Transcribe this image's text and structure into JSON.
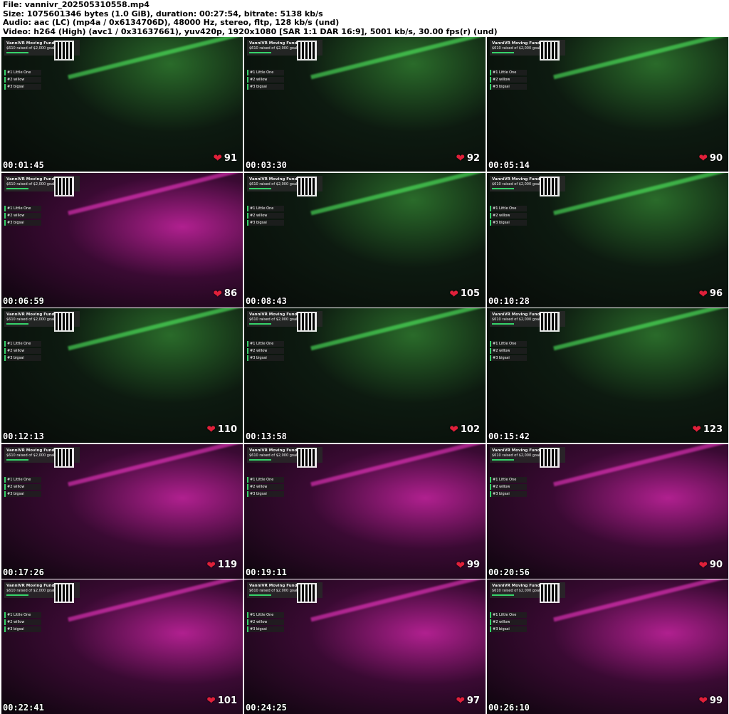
{
  "header": {
    "file": "File: vannivr_2025053105 58.mp4",
    "size": "Size: 1075601346 bytes (1.0 GiB), duration: 00:27:54, bitrate: 5138 kb/s",
    "audio": "Audio: aac (LC) (mp4a / 0x6134706D), 48000 Hz, stereo, fltp, 128 kb/s (und)",
    "video": "Video: h264 (High) (avc1 / 0x31637661), yuv420p, 1920x1080 [SAR 1:1 DAR 16:9], 5001 kb/s, 30.00 fps(r) (und)"
  },
  "overlay": {
    "fund_title": "VanniVR Moving Fund",
    "fund_progress": "$610 raised of $2,000 goal",
    "fund_fraction": 0.305,
    "leaderboard": [
      "#1 Little One",
      "#2 willow",
      "#3 bigsai"
    ]
  },
  "frames": [
    {
      "timestamp": "00:01:45",
      "likes": "91",
      "theme": "g"
    },
    {
      "timestamp": "00:03:30",
      "likes": "92",
      "theme": "g"
    },
    {
      "timestamp": "00:05:14",
      "likes": "90",
      "theme": "g"
    },
    {
      "timestamp": "00:06:59",
      "likes": "86",
      "theme": "m"
    },
    {
      "timestamp": "00:08:43",
      "likes": "105",
      "theme": "g"
    },
    {
      "timestamp": "00:10:28",
      "likes": "96",
      "theme": "g"
    },
    {
      "timestamp": "00:12:13",
      "likes": "110",
      "theme": "g"
    },
    {
      "timestamp": "00:13:58",
      "likes": "102",
      "theme": "g"
    },
    {
      "timestamp": "00:15:42",
      "likes": "123",
      "theme": "g"
    },
    {
      "timestamp": "00:17:26",
      "likes": "119",
      "theme": "m"
    },
    {
      "timestamp": "00:19:11",
      "likes": "99",
      "theme": "m"
    },
    {
      "timestamp": "00:20:56",
      "likes": "90",
      "theme": "m"
    },
    {
      "timestamp": "00:22:41",
      "likes": "101",
      "theme": "m"
    },
    {
      "timestamp": "00:24:25",
      "likes": "97",
      "theme": "m"
    },
    {
      "timestamp": "00:26:10",
      "likes": "99",
      "theme": "m"
    }
  ]
}
